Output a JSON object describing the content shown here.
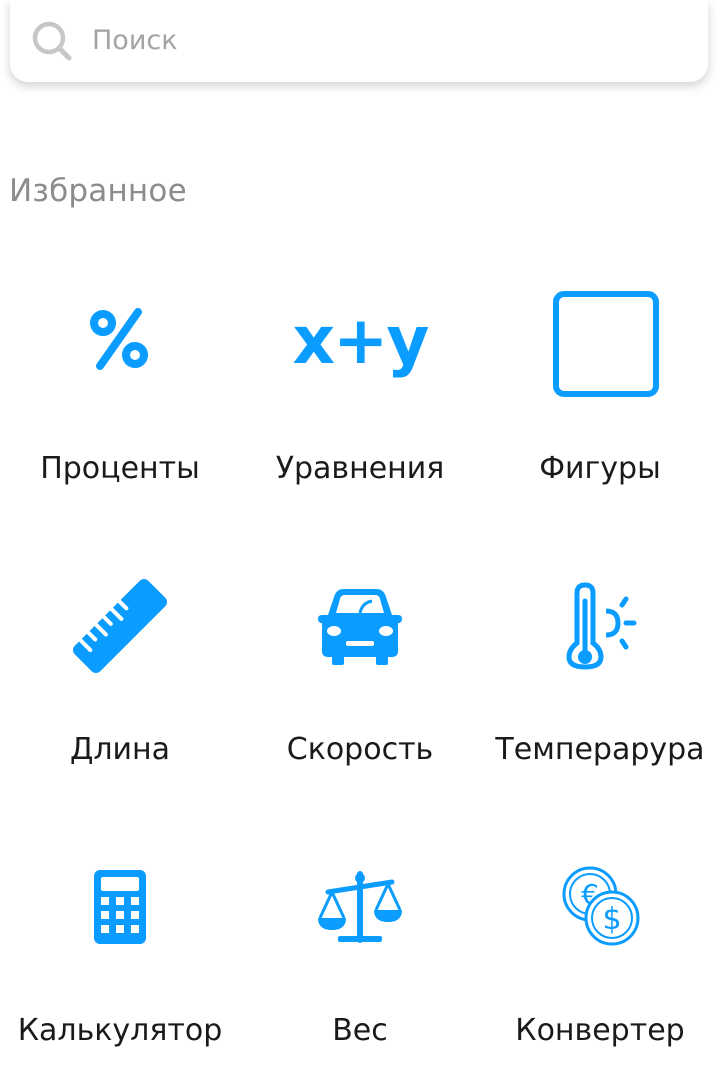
{
  "search": {
    "placeholder": "Поиск",
    "icon": "search-icon"
  },
  "favorites": {
    "title": "Избранное",
    "accent_color": "#0a9cff",
    "items": [
      {
        "label": "Проценты",
        "icon": "percent-icon"
      },
      {
        "label": "Уравнения",
        "icon": "equation-icon",
        "icon_text": "x+y"
      },
      {
        "label": "Фигуры",
        "icon": "square-shape-icon"
      },
      {
        "label": "Длина",
        "icon": "ruler-icon"
      },
      {
        "label": "Скорость",
        "icon": "car-icon"
      },
      {
        "label": "Темперарура",
        "icon": "thermometer-icon"
      },
      {
        "label": "Калькулятор",
        "icon": "calculator-icon"
      },
      {
        "label": "Вес",
        "icon": "scales-icon"
      },
      {
        "label": "Конвертер",
        "icon": "currency-converter-icon"
      }
    ]
  }
}
